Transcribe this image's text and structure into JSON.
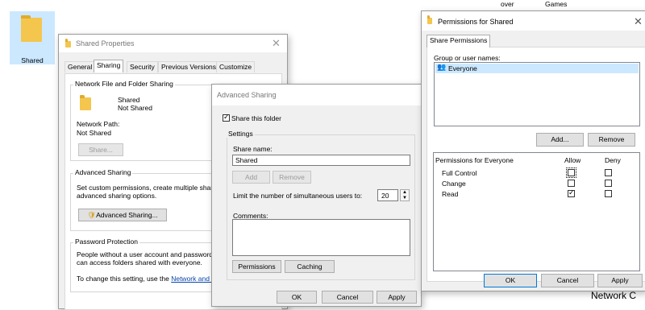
{
  "desktop": {
    "folder_label": "Shared",
    "bg_col1": "over",
    "bg_col2": "Games",
    "bg_bottom_right": "Network C"
  },
  "shared_properties": {
    "title": "Shared Properties",
    "tabs": [
      "General",
      "Sharing",
      "Security",
      "Previous Versions",
      "Customize"
    ],
    "network_group": "Network File and Folder Sharing",
    "folder_name": "Shared",
    "folder_status": "Not Shared",
    "network_path_label": "Network Path:",
    "network_path_value": "Not Shared",
    "share_button": "Share...",
    "advanced_group": "Advanced Sharing",
    "advanced_desc1": "Set custom permissions, create multiple shares",
    "advanced_desc2": "advanced sharing options.",
    "advanced_button": "Advanced Sharing...",
    "password_group": "Password Protection",
    "password_desc1": "People without a user account and password",
    "password_desc2": "can access folders shared with everyone.",
    "change_text": "To change this setting, use the",
    "change_link": "Network and S"
  },
  "advanced_sharing": {
    "title": "Advanced Sharing",
    "share_checkbox": "Share this folder",
    "settings_group": "Settings",
    "share_name_label": "Share name:",
    "share_name_value": "Shared",
    "add_button": "Add",
    "remove_button": "Remove",
    "limit_label": "Limit the number of simultaneous users to:",
    "limit_value": "20",
    "comments_label": "Comments:",
    "permissions_button": "Permissions",
    "caching_button": "Caching",
    "ok_button": "OK",
    "cancel_button": "Cancel",
    "apply_button": "Apply"
  },
  "permissions": {
    "title": "Permissions for Shared",
    "tab": "Share Permissions",
    "group_label": "Group or user names:",
    "users": [
      "Everyone"
    ],
    "add_button": "Add...",
    "remove_button": "Remove",
    "perm_header": "Permissions for Everyone",
    "allow_header": "Allow",
    "deny_header": "Deny",
    "rows": [
      {
        "name": "Full Control",
        "allow": false,
        "deny": false
      },
      {
        "name": "Change",
        "allow": false,
        "deny": false
      },
      {
        "name": "Read",
        "allow": true,
        "deny": false
      }
    ],
    "ok_button": "OK",
    "cancel_button": "Cancel",
    "apply_button": "Apply",
    "accent": "#0078d7"
  }
}
